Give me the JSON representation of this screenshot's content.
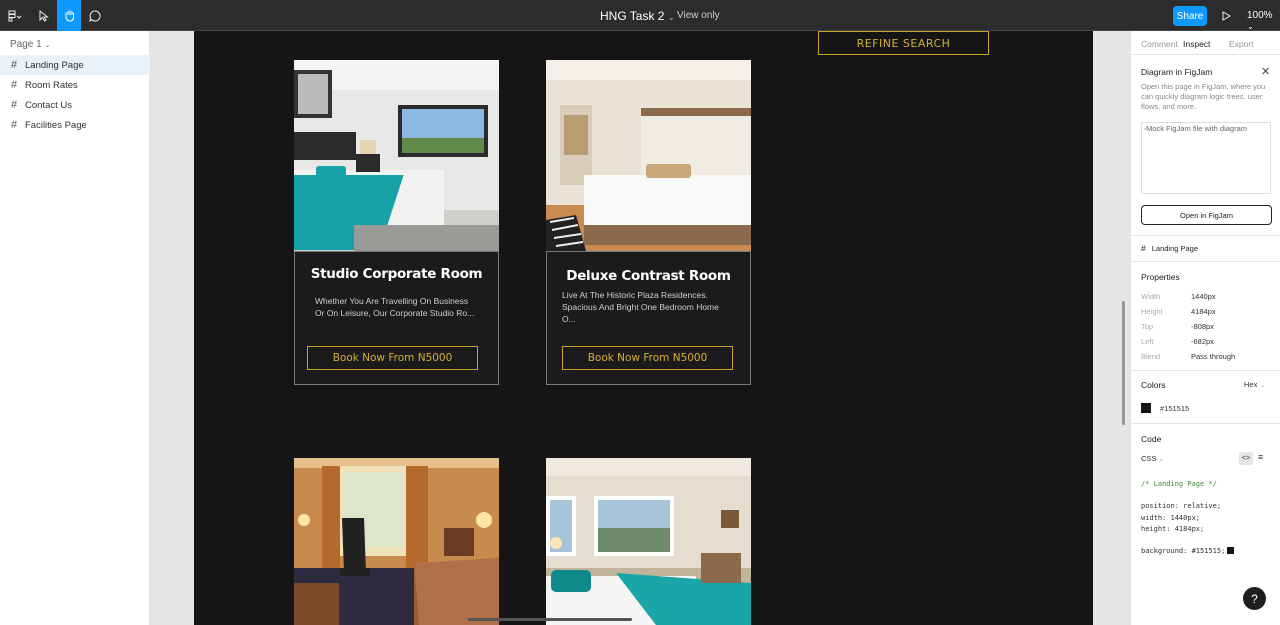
{
  "topbar": {
    "title": "HNG Task 2",
    "view_only": "View only",
    "share": "Share",
    "zoom": "100%"
  },
  "left_panel": {
    "page_select": "Page 1",
    "layers": [
      {
        "label": "Landing Page",
        "selected": true
      },
      {
        "label": "Room Rates"
      },
      {
        "label": "Contact Us"
      },
      {
        "label": "Facilities Page"
      }
    ]
  },
  "design": {
    "refine_search": "REFINE SEARCH",
    "cards": [
      {
        "title": "Studio Corporate Room",
        "desc_line1": "Whether You Are Travelling On Business",
        "desc_line2": "Or On Leisure, Our Corporate Studio Ro...",
        "book": "Book Now From N5000"
      },
      {
        "title": "Deluxe Contrast Room",
        "desc_line1": "Live At The Historic Plaza Residences.",
        "desc_line2": "Spacious And Bright One Bedroom Home",
        "desc_line3": "O...",
        "book": "Book Now From N5000"
      }
    ]
  },
  "right_panel": {
    "tabs": [
      "Comment",
      "Inspect",
      "Export"
    ],
    "active_tab": "Inspect",
    "diagram_title": "Diagram in FigJam",
    "diagram_desc": "Open this page in FigJam, where you can quickly diagram logic trees, user flows, and more.",
    "diagram_img_alt": "Mock FigJam file with diagram",
    "open_figjam": "Open in FigJam",
    "frame_name": "Landing Page",
    "properties_title": "Properties",
    "properties": [
      {
        "k": "Width",
        "v": "1440px"
      },
      {
        "k": "Height",
        "v": "4184px"
      },
      {
        "k": "Top",
        "v": "-808px"
      },
      {
        "k": "Left",
        "v": "-682px"
      },
      {
        "k": "Blend",
        "v": "Pass through"
      }
    ],
    "colors_title": "Colors",
    "color_format": "Hex",
    "color_value": "#151515",
    "code_title": "Code",
    "code_lang": "CSS",
    "code_lines": [
      "/* Landing Page */",
      "position: relative;",
      "width: 1440px;",
      "height: 4184px;",
      "background: #151515;"
    ]
  },
  "colors": {
    "frame_bg": "#151515",
    "accent": "#d4af37",
    "share_blue": "#0d99ff"
  }
}
